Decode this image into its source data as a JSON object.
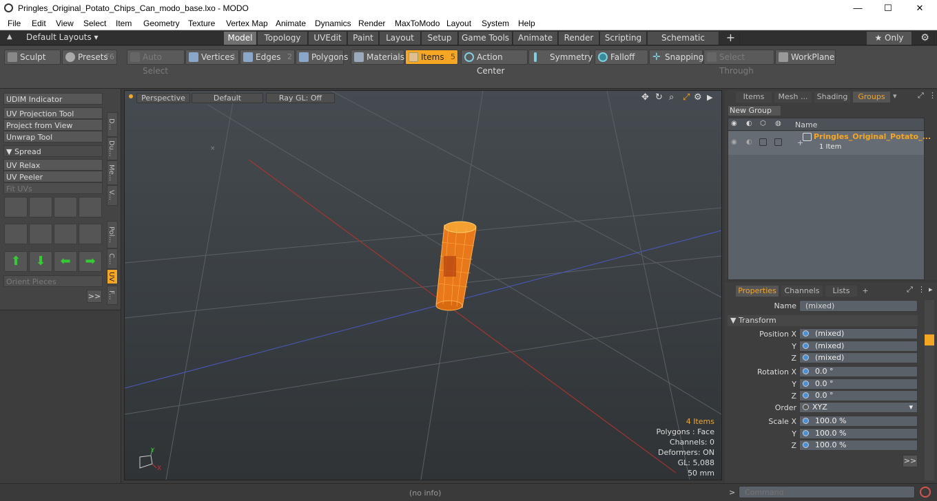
{
  "window": {
    "title": "Pringles_Original_Potato_Chips_Can_modo_base.lxo - MODO",
    "minimize": "—",
    "maximize": "☐",
    "close": "✕"
  },
  "menu": [
    "File",
    "Edit",
    "View",
    "Select",
    "Item",
    "Geometry",
    "Texture",
    "Vertex Map",
    "Animate",
    "Dynamics",
    "Render",
    "MaxToModo",
    "Layout",
    "System",
    "Help"
  ],
  "layout_selector": "Default Layouts ▾",
  "layout_tabs": [
    "Model",
    "Topology",
    "UVEdit",
    "Paint",
    "Layout",
    "Setup",
    "Game Tools",
    "Animate",
    "Render",
    "Scripting",
    "Schematic Fusion",
    "+"
  ],
  "only_label": "★  Only",
  "toolbar": {
    "sculpt": "Sculpt",
    "presets": "Presets",
    "presets_key": "F6",
    "auto_select": "Auto Select",
    "vertices": "Vertices",
    "vertices_key": "1",
    "edges": "Edges",
    "edges_key": "2",
    "polygons": "Polygons",
    "materials": "Materials",
    "items": "Items",
    "items_key": "5",
    "action_center": "Action Center",
    "symmetry": "Symmetry",
    "falloff": "Falloff",
    "snapping": "Snapping",
    "select_through": "Select Through",
    "workplane": "WorkPlane"
  },
  "left_tools": {
    "udim": "UDIM Indicator",
    "uv_projection": "UV Projection Tool",
    "project_from_view": "Project from View",
    "unwrap": "Unwrap Tool",
    "spread": "▼  Spread",
    "uv_relax": "UV Relax",
    "uv_peeler": "UV Peeler",
    "fit_uvs": "Fit UVs",
    "orient_pieces": "Orient Pieces",
    "more": ">>"
  },
  "left_vtabs": [
    "D...",
    "Du...",
    "Me...",
    "V...",
    "Pol...",
    "C...",
    "UV",
    "F..."
  ],
  "viewport": {
    "view": "Perspective",
    "shading": "Default",
    "raygl": "Ray GL: Off",
    "info_items": "4 Items",
    "info_polygons": "Polygons : Face",
    "info_channels": "Channels: 0",
    "info_deformers": "Deformers: ON",
    "info_gl": "GL: 5,088",
    "info_mm": "50 mm",
    "axis_y": "Y",
    "axis_x": "X"
  },
  "right_top": {
    "tabs": [
      "Items",
      "Mesh ...",
      "Shading",
      "Groups"
    ],
    "new_group": "New Group",
    "col_name": "Name",
    "group_name": "Pringles_Original_Potato_...",
    "group_count": "1 Item"
  },
  "properties": {
    "tabs": [
      "Properties",
      "Channels",
      "Lists",
      "+"
    ],
    "name_label": "Name",
    "name_value": "(mixed)",
    "transform": "▼  Transform",
    "pos_x_label": "Position X",
    "pos_x": "(mixed)",
    "pos_y_label": "Y",
    "pos_y": "(mixed)",
    "pos_z_label": "Z",
    "pos_z": "(mixed)",
    "rot_x_label": "Rotation X",
    "rot_x": "0.0 °",
    "rot_y_label": "Y",
    "rot_y": "0.0 °",
    "rot_z_label": "Z",
    "rot_z": "0.0 °",
    "order_label": "Order",
    "order": "XYZ",
    "scale_x_label": "Scale X",
    "scale_x": "100.0 %",
    "scale_y_label": "Y",
    "scale_y": "100.0 %",
    "scale_z_label": "Z",
    "scale_z": "100.0 %",
    "more": ">>"
  },
  "status": {
    "info": "(no info)",
    "prompt": ">",
    "command_placeholder": "Command"
  },
  "colors": {
    "accent": "#f5a623",
    "mesh": "#f08a1c",
    "x_axis": "#c0392b",
    "z_axis": "#4a5ac0"
  }
}
